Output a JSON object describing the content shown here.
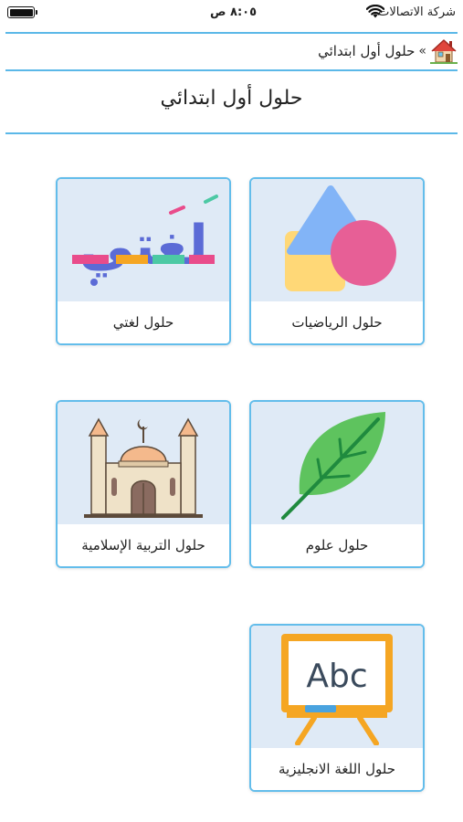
{
  "status_bar": {
    "carrier": "شركة الاتصالات",
    "time": "٨:٠٥ ص"
  },
  "breadcrumb": {
    "separator": "»",
    "current": "حلول أول ابتدائي",
    "home_icon": "house-icon"
  },
  "page": {
    "title": "حلول أول ابتدائي"
  },
  "cards": [
    {
      "label": "حلول الرياضيات",
      "icon": "shapes-icon"
    },
    {
      "label": "حلول لغتي",
      "icon": "lughati-logo",
      "logo_text": "لغتي"
    },
    {
      "label": "حلول علوم",
      "icon": "leaf-icon"
    },
    {
      "label": "حلول التربية الإسلامية",
      "icon": "mosque-icon"
    },
    {
      "label": "حلول اللغة الانجليزية",
      "icon": "abc-board-icon",
      "board_text": "Abc"
    }
  ],
  "colors": {
    "accent": "#5bb8e8",
    "card_background": "#dfeaf6"
  }
}
